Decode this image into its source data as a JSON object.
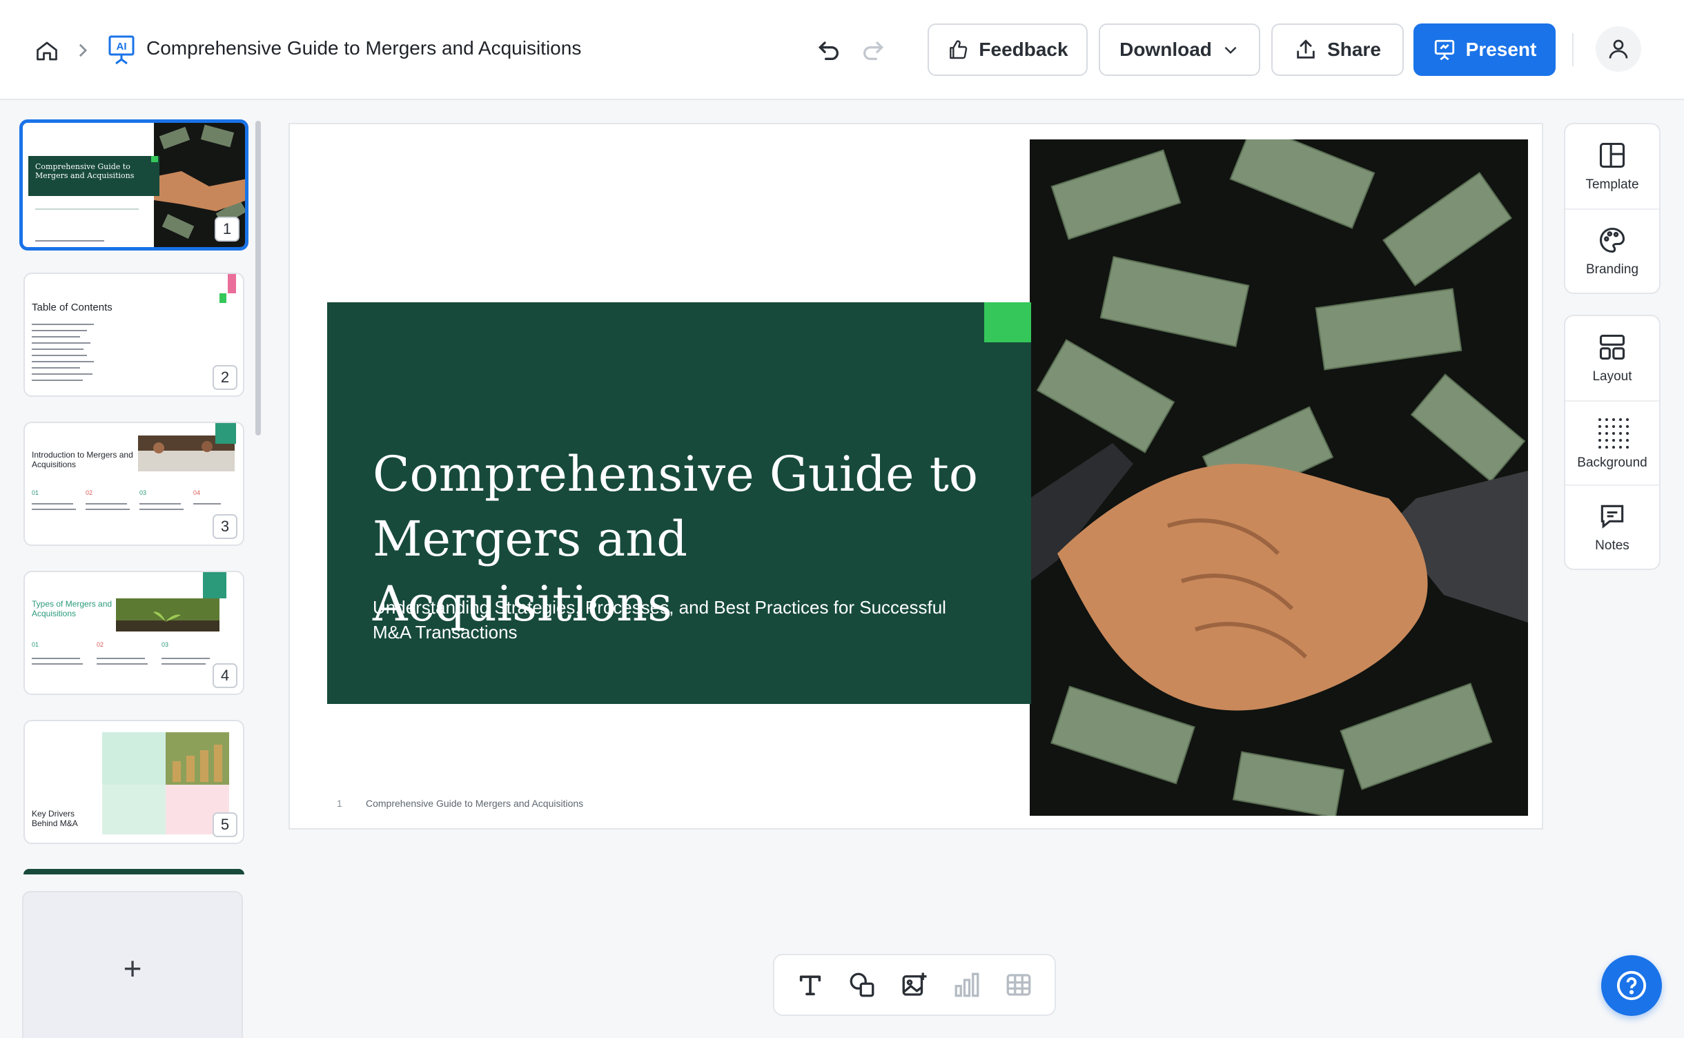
{
  "header": {
    "doc_title": "Comprehensive Guide to Mergers and Acquisitions",
    "doc_icon_text": "AI",
    "feedback_label": "Feedback",
    "download_label": "Download",
    "share_label": "Share",
    "present_label": "Present"
  },
  "thumbnails": [
    {
      "num": "1",
      "title": "Comprehensive Guide to Mergers and Acquisitions"
    },
    {
      "num": "2",
      "title": "Table of Contents"
    },
    {
      "num": "3",
      "title": "Introduction to Mergers and Acquisitions",
      "steps": [
        "01",
        "02",
        "03",
        "04"
      ]
    },
    {
      "num": "4",
      "title": "Types of Mergers and Acquisitions",
      "steps": [
        "01",
        "02",
        "03"
      ]
    },
    {
      "num": "5",
      "title": "Key Drivers Behind M&A"
    }
  ],
  "add_slide_label": "+",
  "slide": {
    "title": "Comprehensive Guide to Mergers and Acquisitions",
    "subtitle": "Understanding Strategies, Processes, and Best Practices for Successful M&A Transactions",
    "footer_num": "1",
    "footer_text": "Comprehensive Guide to Mergers and Acquisitions"
  },
  "tools": {
    "template": "Template",
    "branding": "Branding",
    "layout": "Layout",
    "background": "Background",
    "notes": "Notes"
  },
  "colors": {
    "accent_blue": "#1a73e8",
    "slide_green": "#174a3b",
    "accent_green": "#35c759"
  }
}
